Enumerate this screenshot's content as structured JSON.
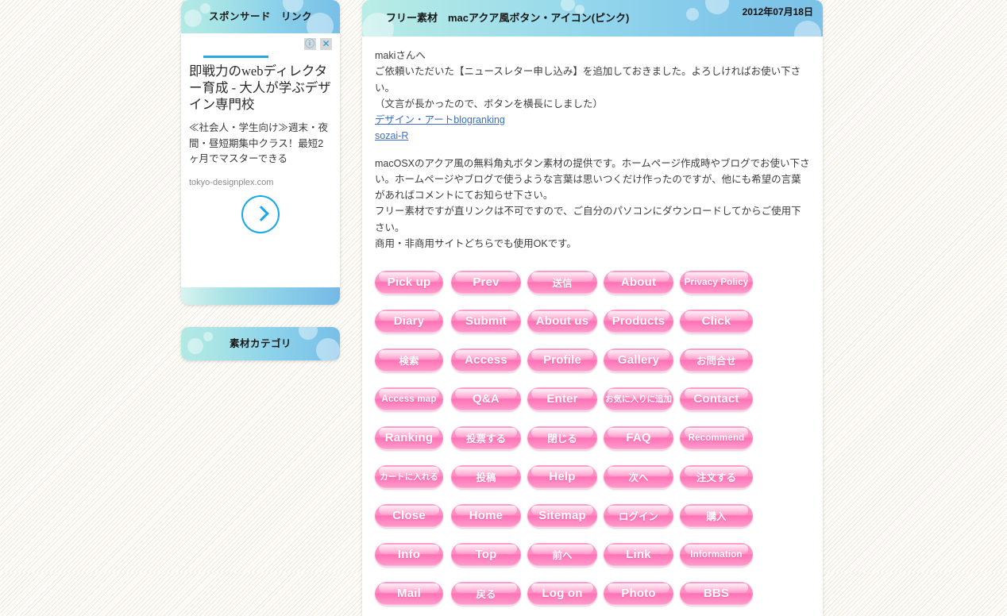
{
  "sidebar": {
    "ad_panel": {
      "head_title": "スポンサード　リンク",
      "badges": [
        "ⓘ",
        "✕"
      ],
      "title": "即戦力のwebディレクター育成 - 大人が学ぶデザイン専門校",
      "description": "≪社会人・学生向け≫週末・夜間・昼短期集中クラス！最短2ヶ月でマスターできる",
      "display_url": "tokyo-designplex.com",
      "arrow_icon": "chevron-right-icon"
    },
    "second_panel": {
      "head_title": "素材カテゴリ"
    }
  },
  "article": {
    "title": "フリー素材　macアクア風ボタン・アイコン(ピンク)",
    "date": "2012年07月18日",
    "greeting": "makiさんへ",
    "note_line1": "ご依頼いただいた【ニュースレター申し込み】を追加しておきました。よろしければお使い下さい。",
    "note_line2": "（文言が長かったので、ボタンを横長にしました）",
    "links": [
      "デザイン・アートblogranking",
      "sozai-R"
    ],
    "paragraph1": "macOSXのアクア風の無料角丸ボタン素材の提供です。ホームページ作成時やブログでお使い下さい。ホームページやブログで使うような言葉は思いつくだけ作ったのですが、他にも希望の言葉があればコメントにてお知らせ下さい。",
    "paragraph2": "フリー素材ですが直リンクは不可ですので、ご自分のパソコンにダウンロードしてからご使用下さい。",
    "paragraph3": "商用・非商用サイトどちらでも使用OKです。"
  },
  "buttons": {
    "accent": "#ff72b5",
    "rows": [
      [
        {
          "label": "Pick up",
          "lang": "en",
          "size": "md",
          "width": "w-s"
        },
        {
          "label": "Prev",
          "lang": "en",
          "size": "md",
          "width": "w-m"
        },
        {
          "label": "送信",
          "lang": "jp",
          "size": "md",
          "width": "w-m"
        },
        {
          "label": "About",
          "lang": "en",
          "size": "md",
          "width": "w-m"
        },
        {
          "label": "Privacy Policy",
          "lang": "en",
          "size": "sm",
          "width": "w-w"
        }
      ],
      [
        {
          "label": "Diary",
          "lang": "en",
          "size": "md",
          "width": "w-s"
        },
        {
          "label": "Submit",
          "lang": "en",
          "size": "md",
          "width": "w-m"
        },
        {
          "label": "About us",
          "lang": "en",
          "size": "md",
          "width": "w-m"
        },
        {
          "label": "Products",
          "lang": "en",
          "size": "md",
          "width": "w-m"
        },
        {
          "label": "Click",
          "lang": "en",
          "size": "md",
          "width": "w-w"
        }
      ],
      [
        {
          "label": "検索",
          "lang": "jp",
          "size": "md",
          "width": "w-s"
        },
        {
          "label": "Access",
          "lang": "en",
          "size": "md",
          "width": "w-m"
        },
        {
          "label": "Profile",
          "lang": "en",
          "size": "md",
          "width": "w-m"
        },
        {
          "label": "Gallery",
          "lang": "en",
          "size": "md",
          "width": "w-m"
        },
        {
          "label": "お問合せ",
          "lang": "jp",
          "size": "md",
          "width": "w-w"
        }
      ],
      [
        {
          "label": "Access map",
          "lang": "en",
          "size": "sm",
          "width": "w-s"
        },
        {
          "label": "Q&A",
          "lang": "en",
          "size": "md",
          "width": "w-m"
        },
        {
          "label": "Enter",
          "lang": "en",
          "size": "md",
          "width": "w-m"
        },
        {
          "label": "お気に入りに追加",
          "lang": "jp",
          "size": "sm",
          "width": "w-m"
        },
        {
          "label": "Contact",
          "lang": "en",
          "size": "md",
          "width": "w-w"
        }
      ],
      [
        {
          "label": "Ranking",
          "lang": "en",
          "size": "md",
          "width": "w-s"
        },
        {
          "label": "投票する",
          "lang": "jp",
          "size": "md",
          "width": "w-m"
        },
        {
          "label": "閉じる",
          "lang": "jp",
          "size": "md",
          "width": "w-m"
        },
        {
          "label": "FAQ",
          "lang": "en",
          "size": "md",
          "width": "w-m"
        },
        {
          "label": "Recommend",
          "lang": "en",
          "size": "sm",
          "width": "w-w"
        }
      ],
      [
        {
          "label": "カートに入れる",
          "lang": "jp",
          "size": "sm",
          "width": "w-s"
        },
        {
          "label": "投稿",
          "lang": "jp",
          "size": "md",
          "width": "w-m"
        },
        {
          "label": "Help",
          "lang": "en",
          "size": "md",
          "width": "w-m"
        },
        {
          "label": "次へ",
          "lang": "jp",
          "size": "md",
          "width": "w-m"
        },
        {
          "label": "注文する",
          "lang": "jp",
          "size": "md",
          "width": "w-w"
        }
      ],
      [
        {
          "label": "Close",
          "lang": "en",
          "size": "md",
          "width": "w-s"
        },
        {
          "label": "Home",
          "lang": "en",
          "size": "md",
          "width": "w-m"
        },
        {
          "label": "Sitemap",
          "lang": "en",
          "size": "md",
          "width": "w-m"
        },
        {
          "label": "ログイン",
          "lang": "jp",
          "size": "md",
          "width": "w-m"
        },
        {
          "label": "購入",
          "lang": "jp",
          "size": "md",
          "width": "w-w"
        }
      ],
      [
        {
          "label": "Info",
          "lang": "en",
          "size": "md",
          "width": "w-s"
        },
        {
          "label": "Top",
          "lang": "en",
          "size": "md",
          "width": "w-m"
        },
        {
          "label": "前へ",
          "lang": "jp",
          "size": "md",
          "width": "w-m"
        },
        {
          "label": "Link",
          "lang": "en",
          "size": "md",
          "width": "w-m"
        },
        {
          "label": "Information",
          "lang": "en",
          "size": "sm",
          "width": "w-w"
        }
      ],
      [
        {
          "label": "Mail",
          "lang": "en",
          "size": "md",
          "width": "w-s"
        },
        {
          "label": "戻る",
          "lang": "jp",
          "size": "md",
          "width": "w-m"
        },
        {
          "label": "Log on",
          "lang": "en",
          "size": "md",
          "width": "w-m"
        },
        {
          "label": "Photo",
          "lang": "en",
          "size": "md",
          "width": "w-m"
        },
        {
          "label": "BBS",
          "lang": "en",
          "size": "md",
          "width": "w-w"
        }
      ]
    ]
  }
}
